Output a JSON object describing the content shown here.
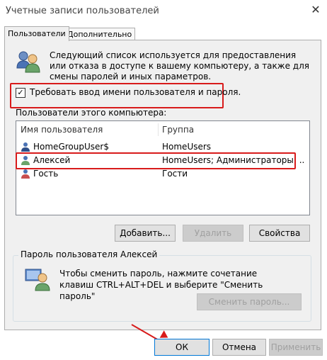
{
  "window": {
    "title": "Учетные записи пользователей",
    "close_glyph": "✕"
  },
  "tabs": [
    {
      "label": "Пользователи",
      "active": true
    },
    {
      "label": "Дополнительно",
      "active": false
    }
  ],
  "description": "Следующий список используется для предоставления или отказа в доступе к вашему компьютеру, а также для смены паролей и иных параметров.",
  "require_login": {
    "label": "Требовать ввод имени пользователя и пароля.",
    "checked": true,
    "check_glyph": "✓"
  },
  "users_section": {
    "label": "Пользователи этого компьютера:",
    "columns": [
      "Имя пользователя",
      "Группа"
    ],
    "rows": [
      {
        "name": "HomeGroupUser$",
        "group": "HomeUsers"
      },
      {
        "name": "Алексей",
        "group": "HomeUsers; Администраторы; ...",
        "selected": true
      },
      {
        "name": "Гость",
        "group": "Гости"
      }
    ]
  },
  "list_buttons": {
    "add": "Добавить...",
    "remove": "Удалить",
    "properties": "Свойства"
  },
  "password_group": {
    "title": "Пароль пользователя Алексей",
    "text": "Чтобы сменить пароль, нажмите сочетание клавиш CTRL+ALT+DEL и выберите \"Сменить пароль\"",
    "button": "Сменить пароль..."
  },
  "dialog_buttons": {
    "ok": "ОК",
    "cancel": "Отмена",
    "apply": "Применить"
  },
  "colors": {
    "highlight": "#d81b1b",
    "accent": "#0078d7"
  },
  "icons": [
    "users-icon",
    "user-icon",
    "user-key-icon",
    "close-icon",
    "checkmark-icon"
  ]
}
